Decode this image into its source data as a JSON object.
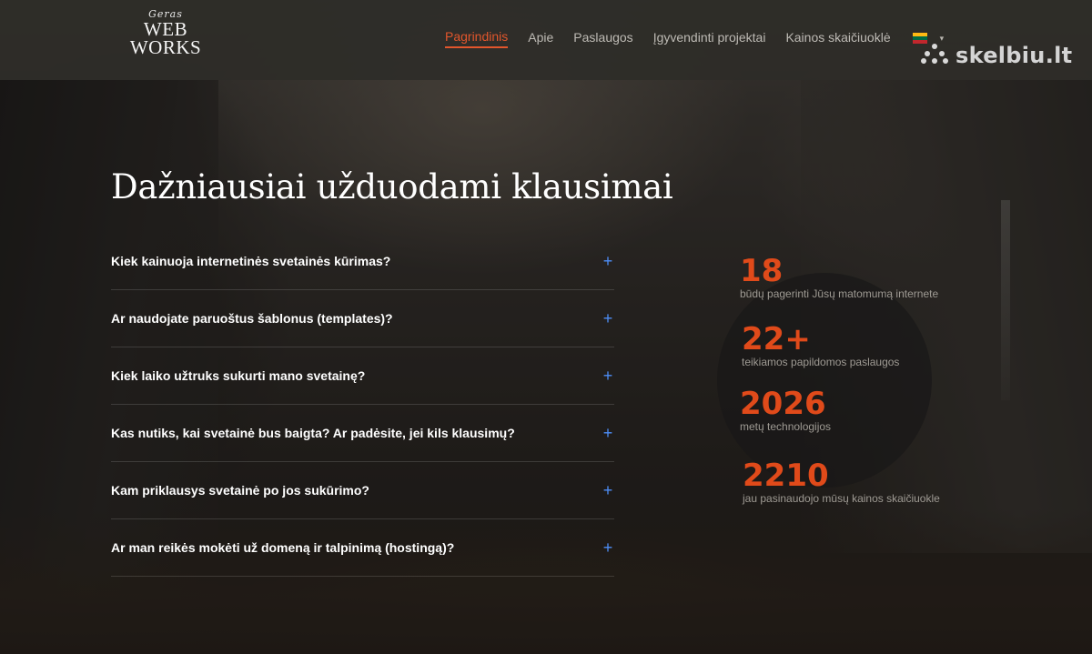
{
  "header": {
    "logo": {
      "script": "Geras",
      "line1": "WEB",
      "line2": "WORKS"
    },
    "nav": [
      {
        "label": "Pagrindinis",
        "active": true
      },
      {
        "label": "Apie",
        "active": false
      },
      {
        "label": "Paslaugos",
        "active": false
      },
      {
        "label": "Įgyvendinti projektai",
        "active": false
      },
      {
        "label": "Kainos skaičiuoklė",
        "active": false
      }
    ],
    "language": {
      "flag": "lithuania-flag-icon",
      "flag_colors": [
        "#fdb913",
        "#006a44",
        "#c1272d"
      ],
      "caret": "▾"
    },
    "watermark": "skelbiu.lt"
  },
  "faq": {
    "title": "Dažniausiai užduodami klausimai",
    "items": [
      {
        "question": "Kiek kainuoja internetinės svetainės kūrimas?",
        "toggle": "+"
      },
      {
        "question": "Ar naudojate paruoštus šablonus (templates)?",
        "toggle": "+"
      },
      {
        "question": "Kiek laiko užtruks sukurti mano svetainę?",
        "toggle": "+"
      },
      {
        "question": "Kas nutiks, kai svetainė bus baigta? Ar padėsite, jei kils klausimų?",
        "toggle": "+"
      },
      {
        "question": "Kam priklausys svetainė po jos sukūrimo?",
        "toggle": "+"
      },
      {
        "question": "Ar man reikės mokėti už domeną ir talpinimą (hostingą)?",
        "toggle": "+"
      }
    ]
  },
  "stats": [
    {
      "number": "18",
      "label": "būdų pagerinti Jūsų matomumą internete"
    },
    {
      "number": "22+",
      "label": "teikiamos papildomos paslaugos"
    },
    {
      "number": "2026",
      "label": "metų technologijos"
    },
    {
      "number": "2210",
      "label": "jau pasinaudojo mūsų kainos skaičiuokle"
    }
  ],
  "colors": {
    "accent": "#e2562c",
    "stat_number": "#e04a1a",
    "faq_toggle": "#4d8ef7"
  }
}
